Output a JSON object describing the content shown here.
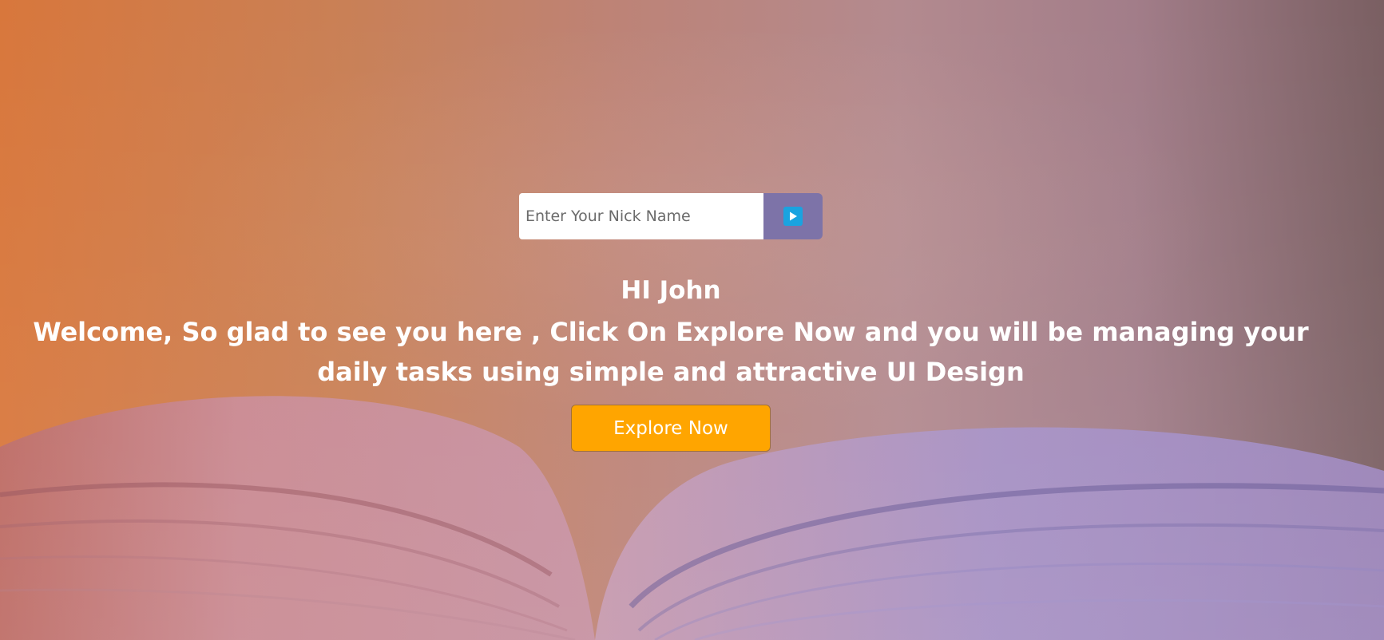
{
  "form": {
    "input_placeholder": "Enter Your Nick Name",
    "input_value": ""
  },
  "hero": {
    "greeting": "HI John",
    "welcome_text": "Welcome, So glad to see you here , Click On Explore Now and you will be managing your daily tasks using simple and attractive UI Design",
    "explore_label": "Explore Now"
  },
  "icons": {
    "submit": "play-icon"
  },
  "colors": {
    "explore_button": "#ffa500",
    "submit_button": "#7d73a8",
    "play_icon": "#1aa3e0",
    "text": "#ffffff"
  }
}
